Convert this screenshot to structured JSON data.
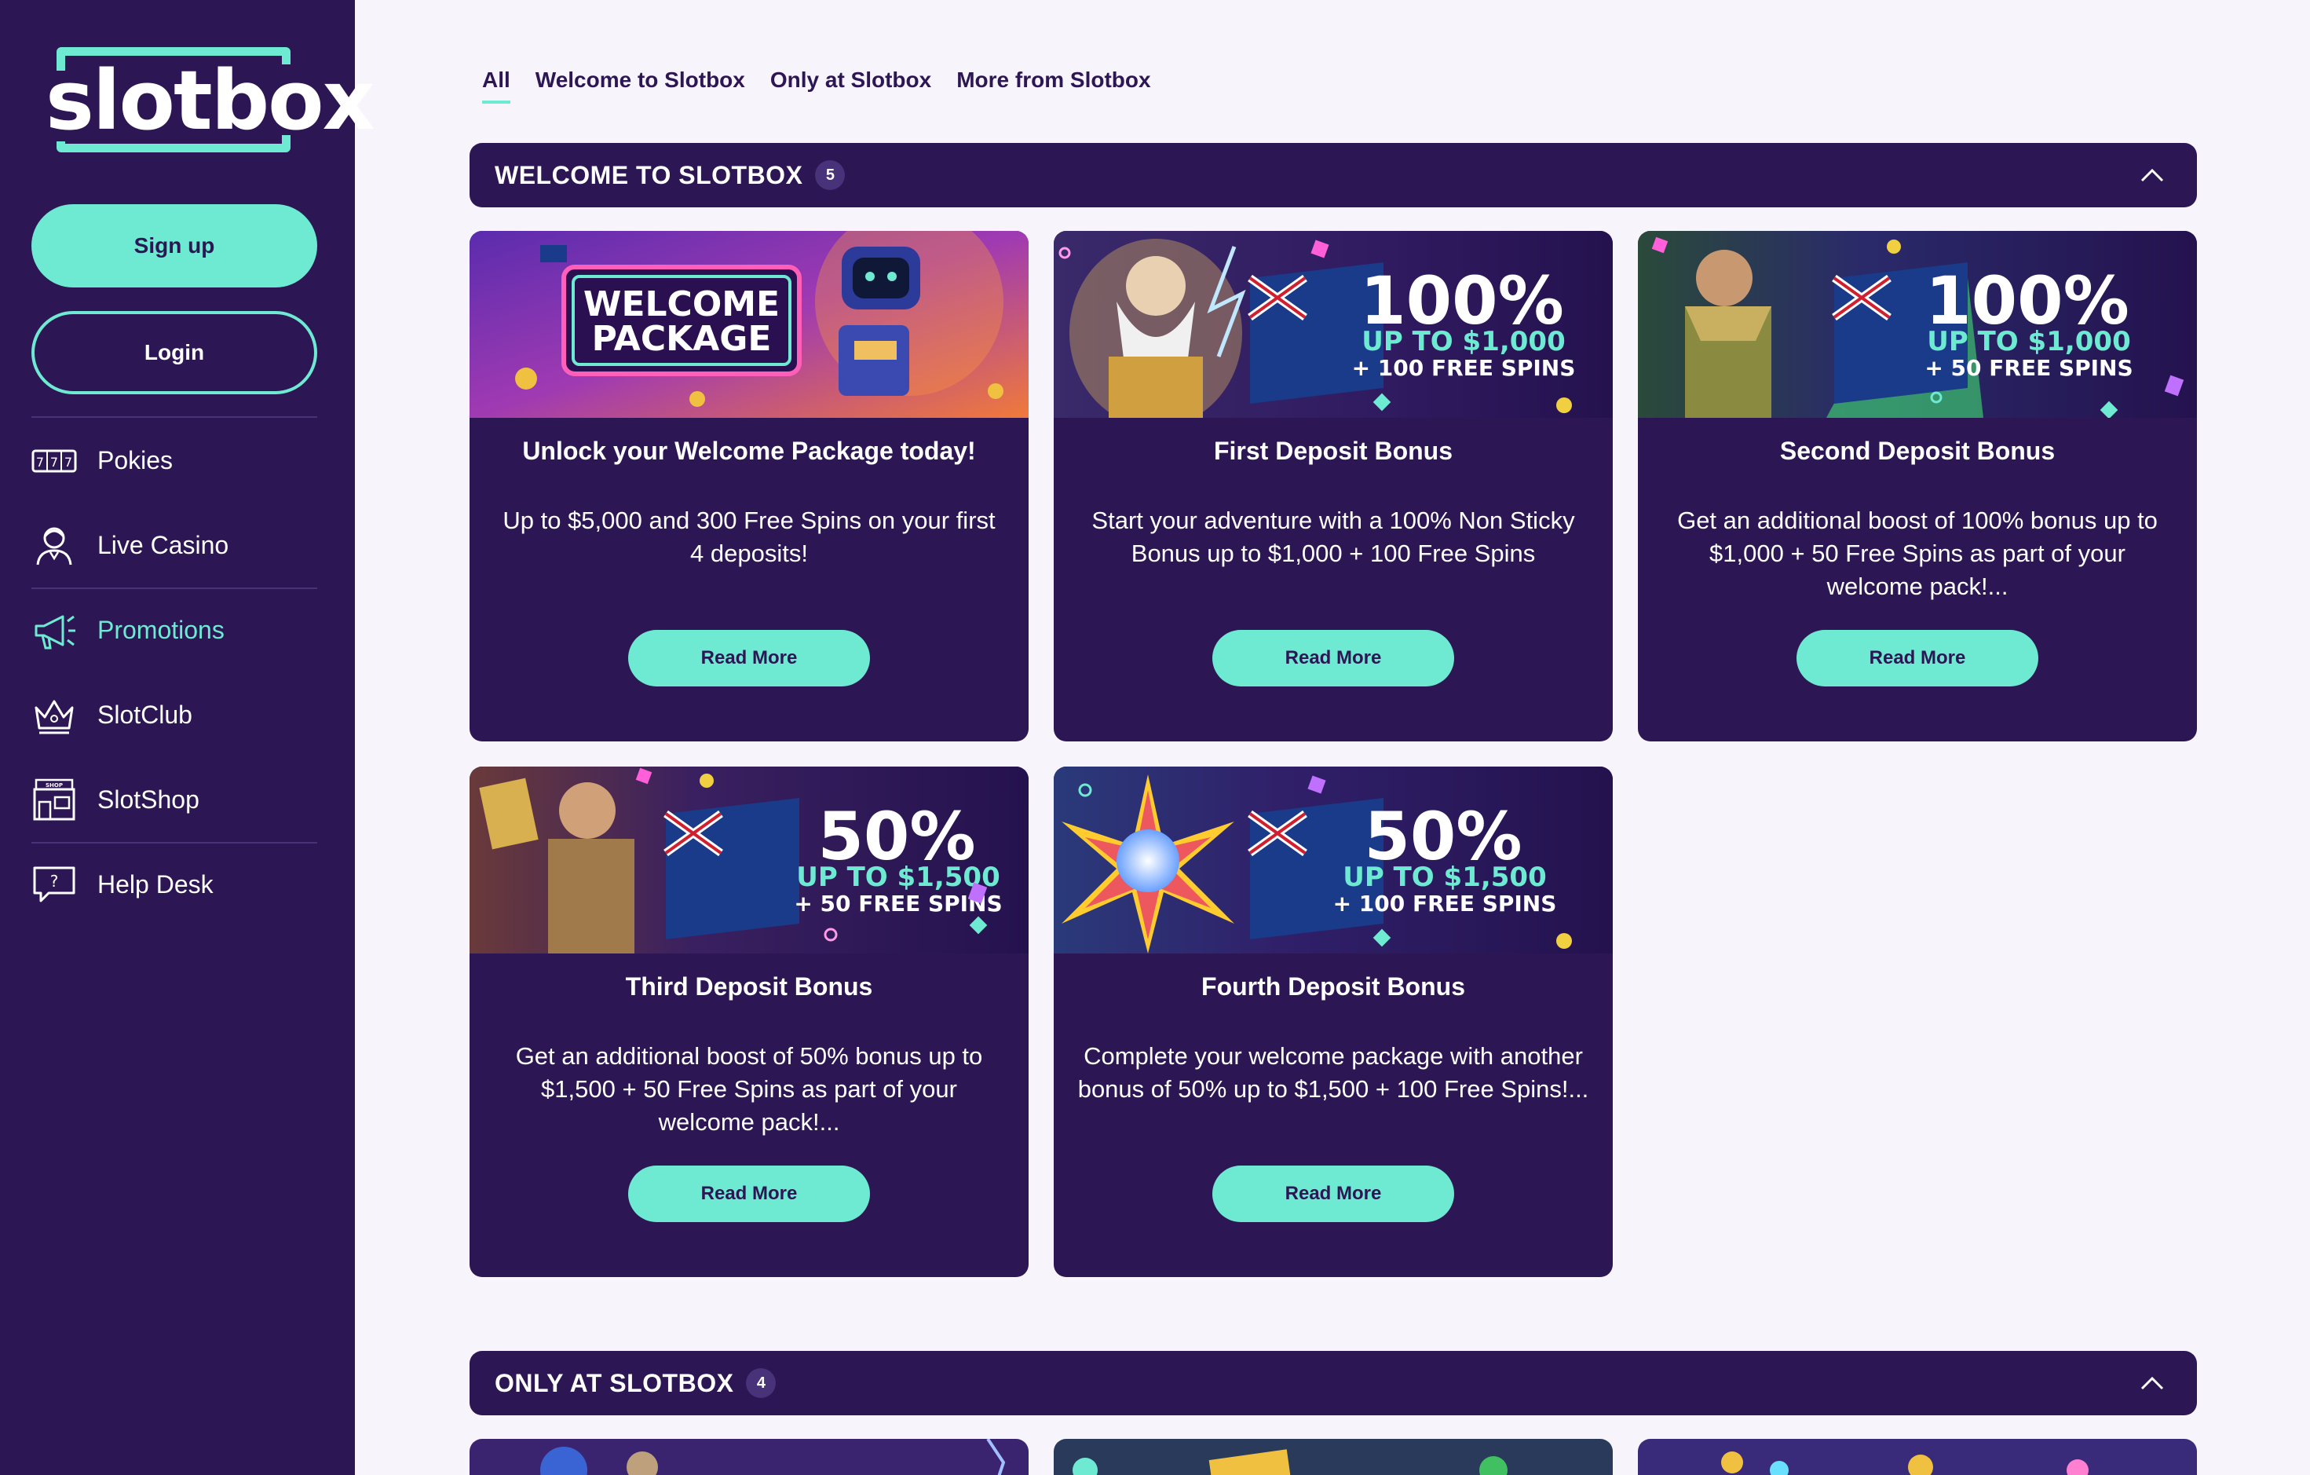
{
  "brand": {
    "logo_text": "slotbox"
  },
  "auth": {
    "signup_label": "Sign up",
    "login_label": "Login"
  },
  "sidebar": {
    "items": [
      {
        "label": "Pokies",
        "icon": "slot-machine-icon"
      },
      {
        "label": "Live Casino",
        "icon": "dealer-icon"
      },
      {
        "label": "Promotions",
        "icon": "megaphone-icon",
        "active": true
      },
      {
        "label": "SlotClub",
        "icon": "crown-icon"
      },
      {
        "label": "SlotShop",
        "icon": "shop-icon"
      },
      {
        "label": "Help Desk",
        "icon": "help-icon"
      }
    ]
  },
  "tabs": [
    {
      "label": "All",
      "active": true
    },
    {
      "label": "Welcome to Slotbox"
    },
    {
      "label": "Only at Slotbox"
    },
    {
      "label": "More from Slotbox"
    }
  ],
  "sections": [
    {
      "title": "WELCOME TO SLOTBOX",
      "count": "5"
    },
    {
      "title": "ONLY AT SLOTBOX",
      "count": "4"
    }
  ],
  "cards": [
    {
      "title": "Unlock your Welcome Package today!",
      "desc": "Up to $5,000 and 300 Free Spins on your first 4 deposits!",
      "button": "Read More",
      "banner": {
        "line1": "WELCOME",
        "line2": "PACKAGE"
      }
    },
    {
      "title": "First Deposit Bonus",
      "desc": "Start your adventure with a 100% Non Sticky Bonus up to $1,000 + 100 Free Spins",
      "button": "Read More",
      "banner": {
        "big": "100%",
        "line2": "UP TO $1,000",
        "line3": "+ 100 FREE SPINS"
      }
    },
    {
      "title": "Second Deposit Bonus",
      "desc": "Get an additional boost of 100% bonus up to $1,000 + 50 Free Spins as part of your welcome pack!...",
      "button": "Read More",
      "banner": {
        "big": "100%",
        "line2": "UP TO $1,000",
        "line3": "+ 50 FREE SPINS"
      }
    },
    {
      "title": "Third Deposit Bonus",
      "desc": "Get an additional boost of 50% bonus up to $1,500 + 50 Free Spins as part of your welcome pack!...",
      "button": "Read More",
      "banner": {
        "big": "50%",
        "line2": "UP TO $1,500",
        "line3": "+ 50 FREE SPINS"
      }
    },
    {
      "title": "Fourth Deposit Bonus",
      "desc": "Complete your welcome package with another bonus of 50% up to $1,500 + 100 Free Spins!...",
      "button": "Read More",
      "banner": {
        "big": "50%",
        "line2": "UP TO $1,500",
        "line3": "+ 100 FREE SPINS"
      }
    }
  ],
  "colors": {
    "sidebar_bg": "#2c1654",
    "accent": "#6ee9d2",
    "page_bg": "#f8f4fb",
    "card_bg": "#2c1654"
  }
}
